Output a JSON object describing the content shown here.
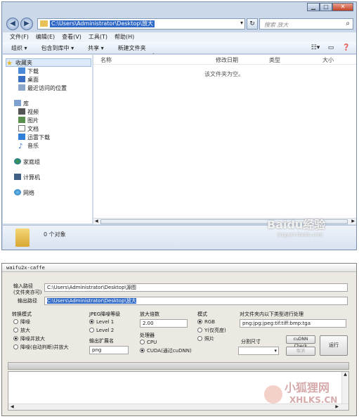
{
  "explorer": {
    "address": "C:\\Users\\Administrator\\Desktop\\放大",
    "search_placeholder": "搜索 放大",
    "menu": [
      "文件(F)",
      "编辑(E)",
      "查看(V)",
      "工具(T)",
      "帮助(H)"
    ],
    "toolbar": [
      "组织 ▾",
      "包含到库中 ▾",
      "共享 ▾",
      "新建文件夹"
    ],
    "nav": {
      "favorites": "收藏夹",
      "downloads": "下载",
      "desktop": "桌面",
      "recent": "最近访问的位置",
      "libraries": "库",
      "videos": "视频",
      "pictures": "图片",
      "documents": "文档",
      "thunder": "迅雷下载",
      "music": "音乐",
      "homegroup": "家庭组",
      "computer": "计算机",
      "network": "网络"
    },
    "columns": [
      "名称",
      "修改日期",
      "类型",
      "大小"
    ],
    "empty_message": "该文件夹为空。",
    "object_count": "0 个对象",
    "watermark": "Baidu经验",
    "watermark_url": "jingyan.baidu.com"
  },
  "waifu": {
    "title": "waifu2x-caffe",
    "input_label": "输入路径\n(文件夹亦可)",
    "input_value": "C:\\Users\\Administrator\\Desktop\\源图",
    "output_label": "输出路径",
    "output_value": "C:\\Users\\Administrator\\Desktop\\放大",
    "mode_title": "转换模式",
    "modes": [
      "降噪",
      "放大",
      "降噪并放大",
      "降噪(自动判断)并放大"
    ],
    "jpeg_title": "JPEG降噪等级",
    "levels": [
      "Level 1",
      "Level 2"
    ],
    "ext_title": "输出扩展名",
    "ext_value": "png",
    "scale_title": "放大倍数",
    "scale_value": "2.00",
    "proc_title": "处理器",
    "procs": [
      "CPU",
      "CUDA(通过cuDNN)"
    ],
    "model_title": "模式",
    "models": [
      "RGB",
      "Y(仅亮度)",
      "照片"
    ],
    "filter_title": "对文件夹内以下类型进行处理",
    "filter_value": "png:jpg:jpeg:tif:tiff:bmp:tga",
    "split_title": "分割尺寸",
    "cudnn_button": "cuDNN Check",
    "cancel_button": "取消",
    "run_button": "运行",
    "watermark": "小狐狸网",
    "watermark_url": "XHLKS.CN"
  }
}
